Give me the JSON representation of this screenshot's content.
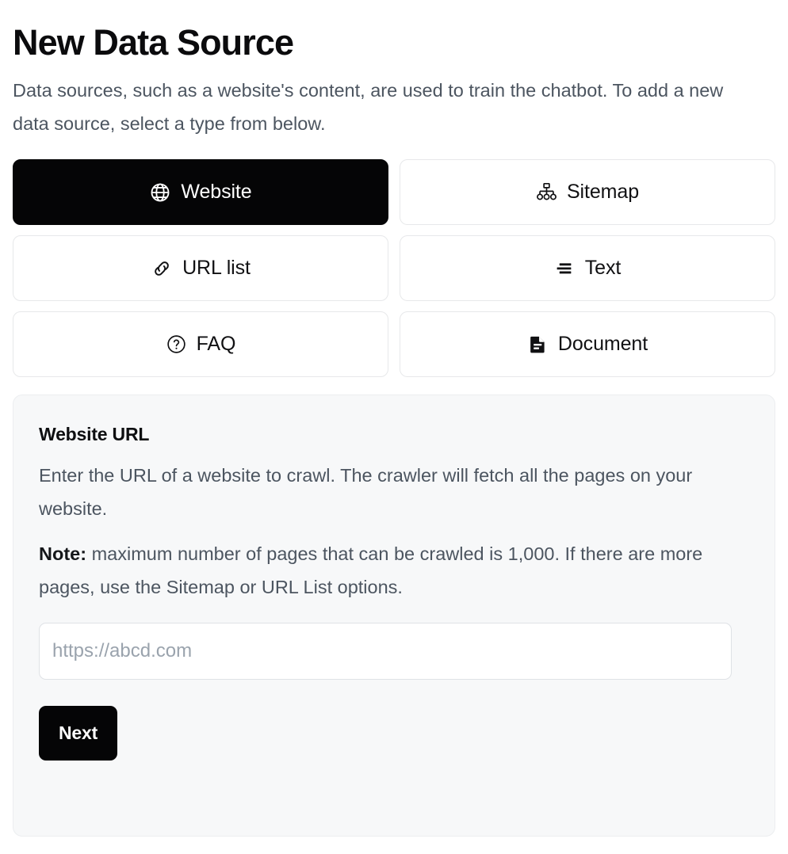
{
  "header": {
    "title": "New Data Source",
    "subtitle": "Data sources, such as a website's content, are used to train the chatbot. To add a new data source, select a type from below."
  },
  "source_types": [
    {
      "id": "website",
      "label": "Website",
      "icon": "globe-icon",
      "selected": true
    },
    {
      "id": "sitemap",
      "label": "Sitemap",
      "icon": "sitemap-icon",
      "selected": false
    },
    {
      "id": "url-list",
      "label": "URL list",
      "icon": "link-icon",
      "selected": false
    },
    {
      "id": "text",
      "label": "Text",
      "icon": "text-lines-icon",
      "selected": false
    },
    {
      "id": "faq",
      "label": "FAQ",
      "icon": "question-circle-icon",
      "selected": false
    },
    {
      "id": "document",
      "label": "Document",
      "icon": "document-icon",
      "selected": false
    }
  ],
  "detail_panel": {
    "title": "Website URL",
    "description": "Enter the URL of a website to crawl. The crawler will fetch all the pages on your website.",
    "note_label": "Note:",
    "note_text": " maximum number of pages that can be crawled is 1,000. If there are more pages, use the Sitemap or URL List options.",
    "url_placeholder": "https://abcd.com",
    "url_value": "",
    "next_label": "Next"
  },
  "colors": {
    "accent": "#050506",
    "panel_bg": "#f7f8f9",
    "border": "#e7e8ea",
    "body_text": "#4c5560",
    "title_text": "#0b0b0d",
    "placeholder": "#9aa3ad"
  }
}
